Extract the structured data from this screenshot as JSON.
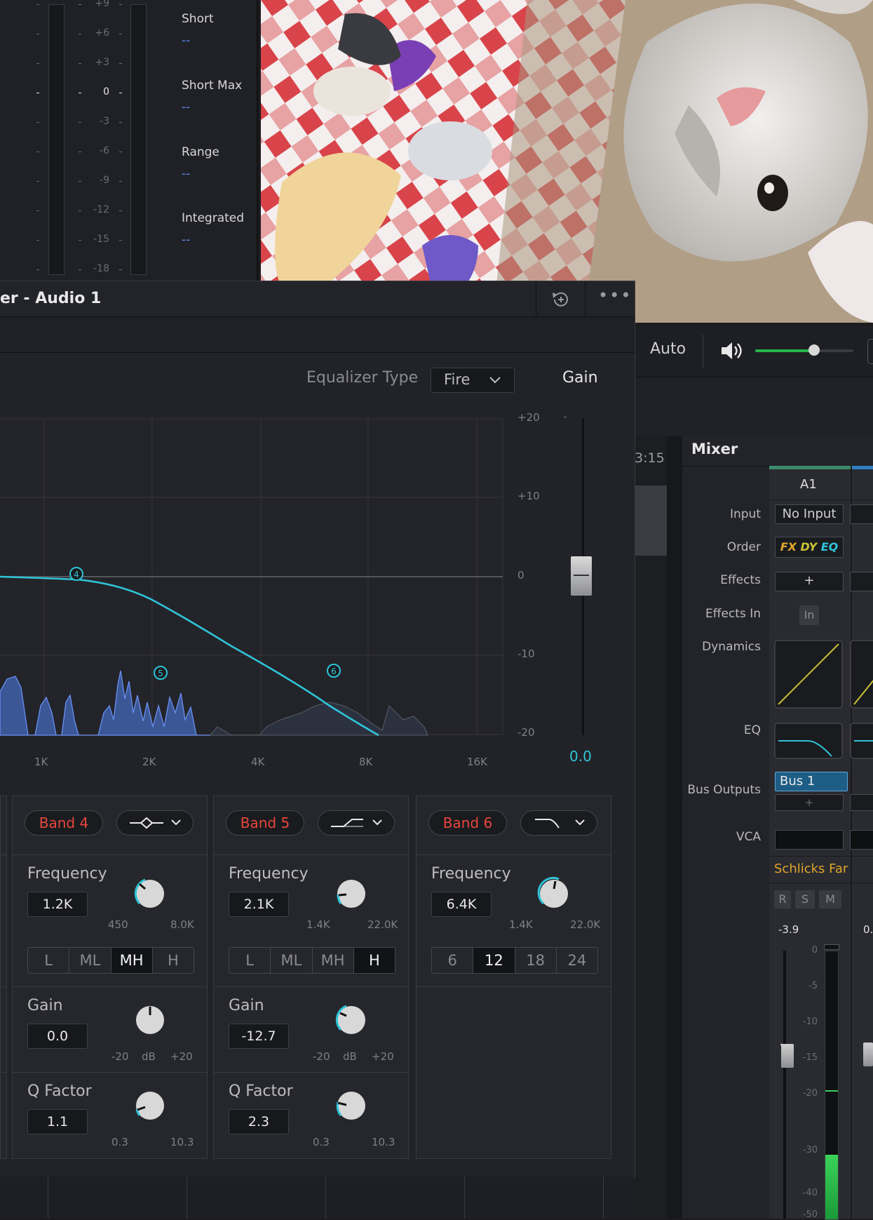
{
  "loudness": {
    "scale": [
      "+9",
      "+6",
      "+3",
      "0",
      "-3",
      "-6",
      "-9",
      "-12",
      "-15",
      "-18"
    ],
    "items": [
      {
        "label": "Short",
        "value": "--"
      },
      {
        "label": "Short Max",
        "value": "--"
      },
      {
        "label": "Range",
        "value": "--"
      },
      {
        "label": "Integrated",
        "value": "--"
      }
    ]
  },
  "eq": {
    "title": "er - Audio 1",
    "type_label": "Equalizer Type",
    "type_value": "Fire",
    "gain_label": "Gain",
    "gain_value": "0.0",
    "db_ticks": [
      "+20",
      "+10",
      "0",
      "-10",
      "-20"
    ],
    "freq_ticks": [
      "1K",
      "2K",
      "4K",
      "8K",
      "16K"
    ],
    "nodes": [
      "4",
      "5",
      "6"
    ],
    "bands": [
      {
        "name": "Band 4",
        "freq_label": "Frequency",
        "freq": "1.2K",
        "fmin": "450",
        "fmax": "8.0K",
        "shape": [
          "L",
          "ML",
          "MH",
          "H"
        ],
        "shape_on": 2,
        "gain_label": "Gain",
        "gain": "0.0",
        "gmin": "-20",
        "gunit": "dB",
        "gmax": "+20",
        "q_label": "Q Factor",
        "q": "1.1",
        "qmin": "0.3",
        "qmax": "10.3"
      },
      {
        "name": "Band 5",
        "freq_label": "Frequency",
        "freq": "2.1K",
        "fmin": "1.4K",
        "fmax": "22.0K",
        "shape": [
          "L",
          "ML",
          "MH",
          "H"
        ],
        "shape_on": 3,
        "gain_label": "Gain",
        "gain": "-12.7",
        "gmin": "-20",
        "gunit": "dB",
        "gmax": "+20",
        "q_label": "Q Factor",
        "q": "2.3",
        "qmin": "0.3",
        "qmax": "10.3"
      },
      {
        "name": "Band 6",
        "freq_label": "Frequency",
        "freq": "6.4K",
        "fmin": "1.4K",
        "fmax": "22.0K",
        "shape": [
          "6",
          "12",
          "18",
          "24"
        ],
        "shape_on": 1
      }
    ]
  },
  "transport": {
    "auto": "Auto",
    "timecode": "3:15",
    "volume_level": 0.6
  },
  "mixer": {
    "title": "Mixer",
    "channel": "A1",
    "labels": [
      "Input",
      "Order",
      "Effects",
      "Effects In",
      "Dynamics",
      "EQ",
      "Bus Outputs",
      "VCA"
    ],
    "input": "No Input",
    "order": [
      "FX",
      "DY",
      "EQ"
    ],
    "effects_add": "+",
    "effects_in": "In",
    "bus": "Bus 1",
    "bus_add": "+",
    "track_name": "Schlicks Far",
    "rsm": [
      "R",
      "S",
      "M"
    ],
    "peak": "-3.9",
    "peak2": "0.",
    "fader_scale": [
      "0",
      "-5",
      "-10",
      "-15",
      "-20",
      "-30",
      "-40",
      "-50"
    ]
  },
  "colors": {
    "accent": "#2fc4d8",
    "band_red": "#e8463c",
    "meter_blue": "#5b8fe6",
    "green": "#27b34a",
    "track_name": "#e0a52a"
  }
}
